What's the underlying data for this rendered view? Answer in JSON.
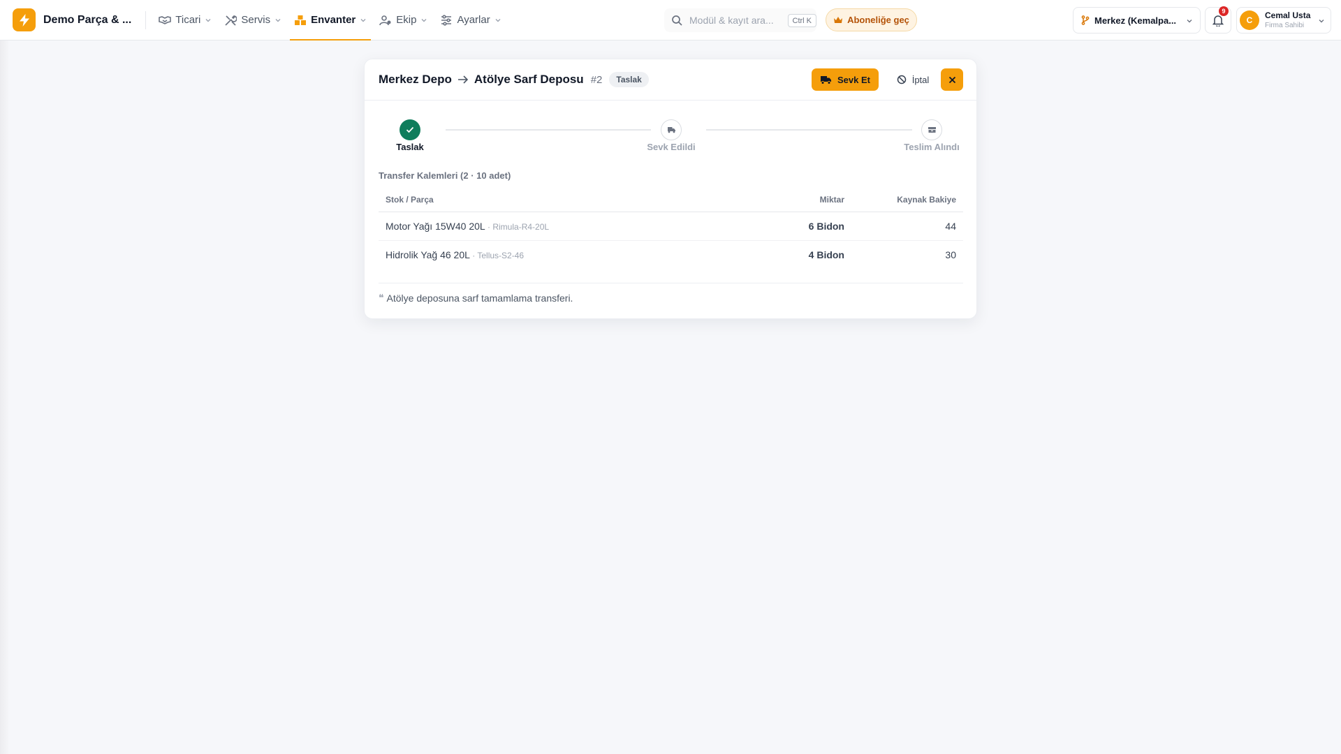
{
  "app": {
    "name": "Demo Parça & ..."
  },
  "nav": {
    "items": [
      {
        "label": "Ticari",
        "icon": "handshake-icon",
        "active": false
      },
      {
        "label": "Servis",
        "icon": "tools-icon",
        "active": false
      },
      {
        "label": "Envanter",
        "icon": "boxes-icon",
        "active": true
      },
      {
        "label": "Ekip",
        "icon": "users-icon",
        "active": false
      },
      {
        "label": "Ayarlar",
        "icon": "sliders-icon",
        "active": false
      }
    ]
  },
  "search": {
    "placeholder": "Modül & kayıt ara...",
    "shortcut": "Ctrl K"
  },
  "upgrade": {
    "label": "Aboneliğe geç"
  },
  "branch": {
    "label": "Merkez (Kemalpa..."
  },
  "notifications": {
    "count": "9"
  },
  "user": {
    "initial": "C",
    "name": "Cemal Usta",
    "role": "Firma Sahibi"
  },
  "transfer": {
    "source": "Merkez Depo",
    "target": "Atölye Sarf Deposu",
    "code": "#2",
    "status": "Taslak",
    "actions": {
      "ship": "Sevk Et",
      "cancel": "İptal"
    },
    "steps": [
      {
        "label": "Taslak",
        "state": "done"
      },
      {
        "label": "Sevk Edildi",
        "state": "pending"
      },
      {
        "label": "Teslim Alındı",
        "state": "pending"
      }
    ],
    "items_title": "Transfer Kalemleri (2 · 10 adet)",
    "columns": {
      "item": "Stok / Parça",
      "qty": "Miktar",
      "balance": "Kaynak Bakiye"
    },
    "items": [
      {
        "name": "Motor Yağı 15W40 20L",
        "sku": " · Rimula-R4-20L",
        "qty": "6 Bidon",
        "balance": "44"
      },
      {
        "name": "Hidrolik Yağ 46 20L",
        "sku": " · Tellus-S2-46",
        "qty": "4 Bidon",
        "balance": "30"
      }
    ],
    "note": "Atölye deposuna sarf tamamlama transferi."
  },
  "colors": {
    "accent": "#f59e0b",
    "success": "#0f7d5c",
    "danger": "#dc2626"
  }
}
